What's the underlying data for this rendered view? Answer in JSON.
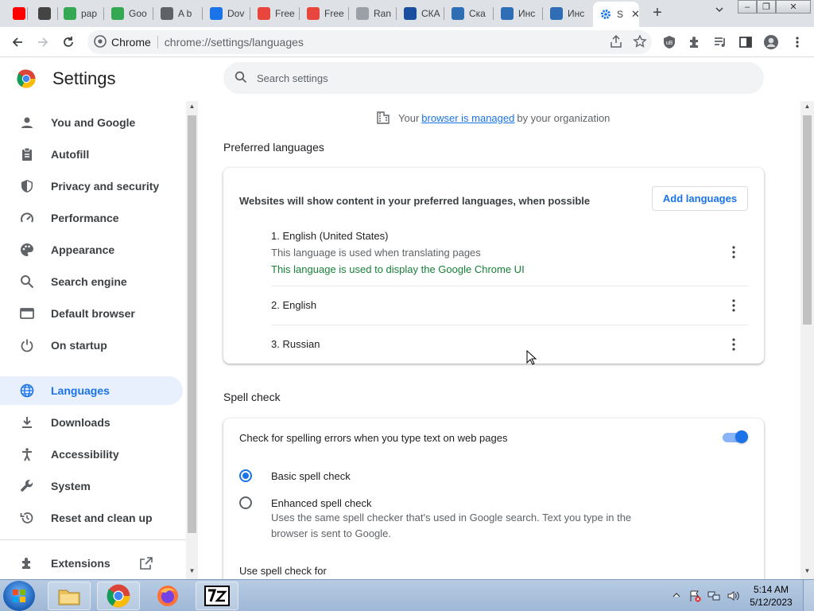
{
  "tabs": [
    {
      "label": "(",
      "fav_color": "#ff0000",
      "icon": "youtube-icon"
    },
    {
      "label": "",
      "fav_color": "#444444",
      "icon": "audio-icon"
    },
    {
      "label": "pap",
      "fav_color": "#34a853",
      "icon": "drive-icon"
    },
    {
      "label": "Goo",
      "fav_color": "#34a853",
      "icon": "drive-icon"
    },
    {
      "label": "A b",
      "fav_color": "#5f6368",
      "icon": "globe-icon"
    },
    {
      "label": "Dov",
      "fav_color": "#1a73e8",
      "icon": "download-icon"
    },
    {
      "label": "Free",
      "fav_color": "#e8453c",
      "icon": "site-icon"
    },
    {
      "label": "Free",
      "fav_color": "#e8453c",
      "icon": "site-icon"
    },
    {
      "label": "Ran",
      "fav_color": "#9aa0a6",
      "icon": "page-icon"
    },
    {
      "label": "СКА",
      "fav_color": "#1a4e9e",
      "icon": "site-icon"
    },
    {
      "label": "Ска",
      "fav_color": "#2f6db5",
      "icon": "site-icon"
    },
    {
      "label": "Инс",
      "fav_color": "#2f6db5",
      "icon": "site-icon"
    },
    {
      "label": "Инс",
      "fav_color": "#2f6db5",
      "icon": "site-icon"
    },
    {
      "label": "S",
      "fav_color": "#1a73e8",
      "icon": "settings-icon"
    }
  ],
  "omnibox": {
    "site_name": "Chrome",
    "url": "chrome://settings/languages"
  },
  "header": {
    "title": "Settings",
    "search_placeholder": "Search settings"
  },
  "sidebar": {
    "items": [
      {
        "label": "You and Google",
        "icon": "person-icon"
      },
      {
        "label": "Autofill",
        "icon": "clipboard-icon"
      },
      {
        "label": "Privacy and security",
        "icon": "shield-icon"
      },
      {
        "label": "Performance",
        "icon": "speedometer-icon"
      },
      {
        "label": "Appearance",
        "icon": "palette-icon"
      },
      {
        "label": "Search engine",
        "icon": "search-icon"
      },
      {
        "label": "Default browser",
        "icon": "browser-icon"
      },
      {
        "label": "On startup",
        "icon": "power-icon"
      },
      {
        "label": "Languages",
        "icon": "globe-icon",
        "active": true
      },
      {
        "label": "Downloads",
        "icon": "download-icon"
      },
      {
        "label": "Accessibility",
        "icon": "accessibility-icon"
      },
      {
        "label": "System",
        "icon": "wrench-icon"
      },
      {
        "label": "Reset and clean up",
        "icon": "restore-icon"
      }
    ],
    "extensions_label": "Extensions"
  },
  "managed": {
    "prefix": "Your",
    "link": "browser is managed",
    "suffix": "by your organization"
  },
  "preferred": {
    "section_title": "Preferred languages",
    "description": "Websites will show content in your preferred languages, when possible",
    "add_button": "Add languages",
    "languages": [
      {
        "name": "1. English (United States)",
        "sub": "This language is used when translating pages",
        "ui_note": "This language is used to display the Google Chrome UI"
      },
      {
        "name": "2. English"
      },
      {
        "name": "3. Russian"
      }
    ]
  },
  "spellcheck": {
    "section_title": "Spell check",
    "toggle_label": "Check for spelling errors when you type text on web pages",
    "toggle_on": true,
    "basic_label": "Basic spell check",
    "enhanced_label": "Enhanced spell check",
    "enhanced_desc": "Uses the same spell checker that's used in Google search. Text you type in the browser is sent to Google.",
    "selected": "basic",
    "use_for_label": "Use spell check for"
  },
  "taskbar": {
    "time": "5:14 AM",
    "date": "5/12/2023"
  },
  "colors": {
    "accent": "#1a73e8",
    "green": "#188038",
    "active_nav_bg": "#e8f0fe"
  }
}
